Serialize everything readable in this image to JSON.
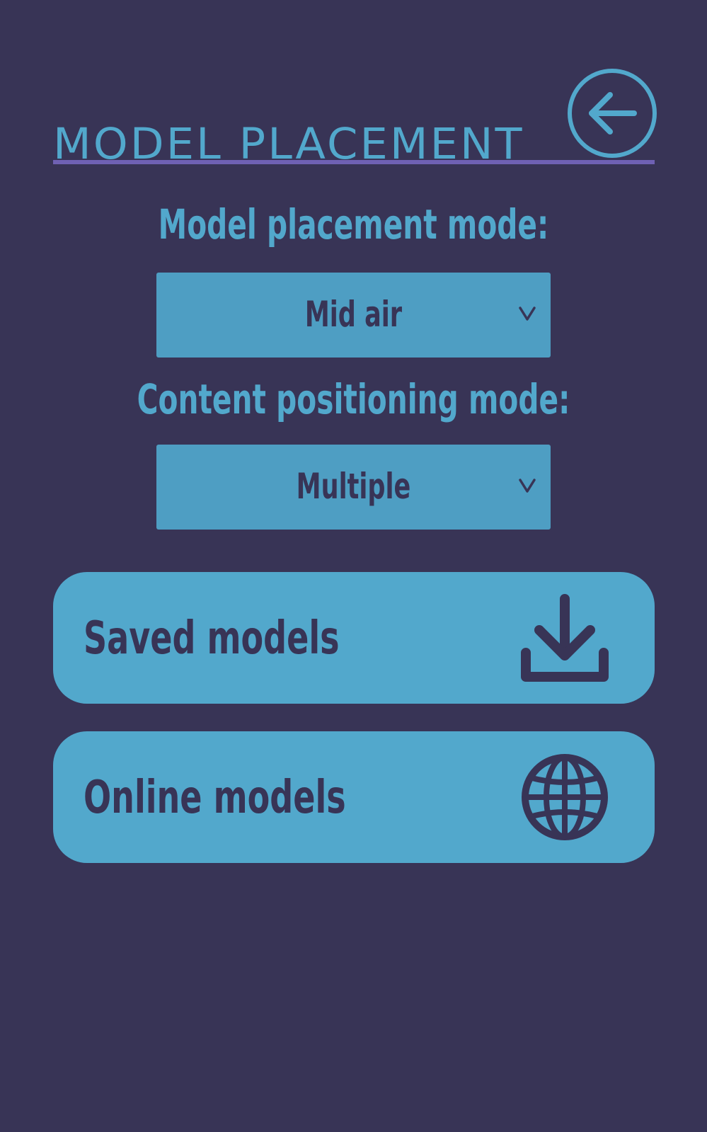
{
  "header": {
    "title": "MODEL PLACEMENT",
    "back_icon": "arrow-left-circle-icon"
  },
  "placement": {
    "label": "Model placement mode:",
    "selected": "Mid air",
    "icon": "chevron-down-icon"
  },
  "positioning": {
    "label": "Content positioning mode:",
    "selected": "Multiple",
    "icon": "chevron-down-icon"
  },
  "buttons": {
    "saved": {
      "label": "Saved models",
      "icon": "download-icon"
    },
    "online": {
      "label": "Online models",
      "icon": "globe-icon"
    }
  },
  "colors": {
    "background": "#383456",
    "accent": "#52a8cc",
    "underline": "#6f61b3",
    "text_dark": "#383456"
  }
}
